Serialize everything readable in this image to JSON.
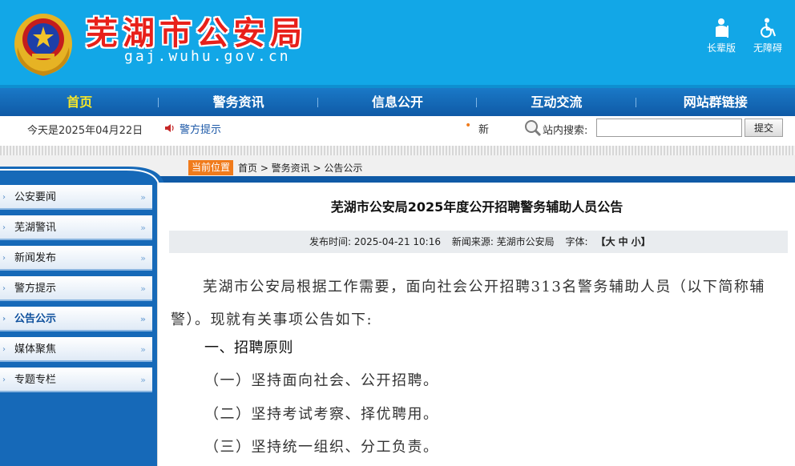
{
  "header": {
    "title": "芜湖市公安局",
    "domain": "gaj.wuhu.gov.cn",
    "tools": [
      {
        "label": "长辈版",
        "icon": "elderly-person-icon"
      },
      {
        "label": "无障碍",
        "icon": "wheelchair-icon"
      }
    ]
  },
  "nav": {
    "items": [
      "首页",
      "警务资讯",
      "信息公开",
      "互动交流",
      "网站群链接"
    ],
    "active_index": 0
  },
  "infobar": {
    "today": "今天是2025年04月22日",
    "notice_label": "警方提示",
    "ticker": "新",
    "search_label": "站内搜索:",
    "search_value": "",
    "search_button": "提交"
  },
  "breadcrumb": {
    "badge": "当前位置",
    "path": "首页 > 警务资讯 > 公告公示"
  },
  "sidebar": {
    "items": [
      "公安要闻",
      "芜湖警讯",
      "新闻发布",
      "警方提示",
      "公告公示",
      "媒体聚焦",
      "专题专栏"
    ],
    "active_index": 4
  },
  "article": {
    "title": "芜湖市公安局2025年度公开招聘警务辅助人员公告",
    "meta": {
      "publish_time": "发布时间: 2025-04-21 10:16",
      "source": "新闻来源: 芜湖市公安局",
      "font_label": "字体:",
      "font_open": "【",
      "font_large": "大",
      "font_medium": "中",
      "font_small": "小",
      "font_close": "】"
    },
    "para1": "芜湖市公安局根据工作需要，面向社会公开招聘313名警务辅助人员（以下简称辅警）。现就有关事项公告如下:",
    "heading1": "一、招聘原则",
    "items": [
      "（一）坚持面向社会、公开招聘。",
      "（二）坚持考试考察、择优聘用。",
      "（三）坚持统一组织、分工负责。"
    ]
  },
  "colors": {
    "header_bg": "#12a7e7",
    "nav_bg": "#0f5aa6",
    "nav_active": "#f7e728",
    "title_red": "#e8201a",
    "badge_orange": "#f07b1c",
    "sidebar_bg": "#1669b8"
  }
}
